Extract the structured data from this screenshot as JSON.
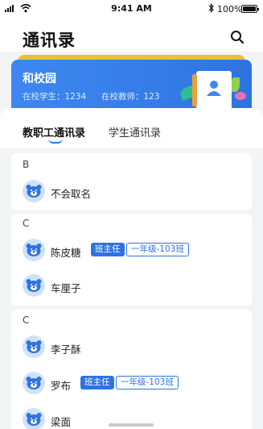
{
  "status_bar": {
    "time": "9:41 AM",
    "battery": "100%"
  },
  "header": {
    "title": "通讯录"
  },
  "school_card": {
    "name": "和校园",
    "students_label": "在校学生：1234",
    "teachers_label": "在校教师：123"
  },
  "tabs": [
    {
      "label": "教职工通讯录",
      "active": true
    },
    {
      "label": "学生通讯录",
      "active": false
    }
  ],
  "groups": [
    {
      "letter": "B",
      "contacts": [
        {
          "name": "不会取名"
        }
      ]
    },
    {
      "letter": "C",
      "contacts": [
        {
          "name": "陈皮糖",
          "role": "班主任",
          "class": "一年级-103班"
        },
        {
          "name": "车厘子"
        }
      ]
    },
    {
      "letter": "C",
      "contacts": [
        {
          "name": "李子酥"
        },
        {
          "name": "罗布",
          "role": "班主任",
          "class": "一年级-103班"
        },
        {
          "name": "梁面"
        }
      ]
    }
  ],
  "colors": {
    "accent": "#2d74e2",
    "card_tab": "#e7c233",
    "avatar_bg": "#cfe2f8"
  }
}
